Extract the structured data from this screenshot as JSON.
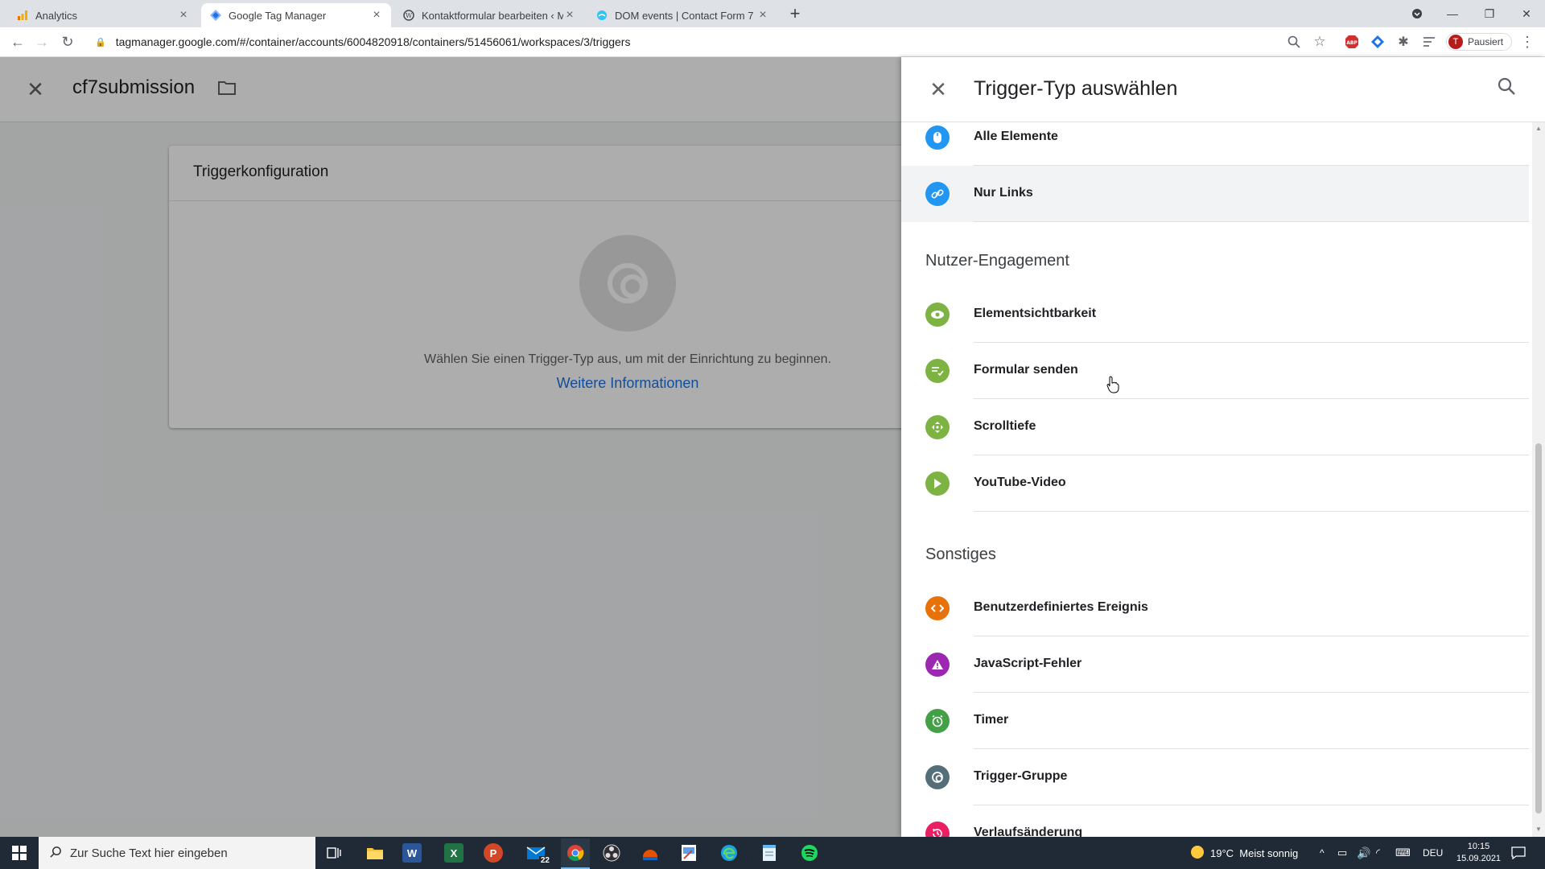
{
  "browser": {
    "tabs": [
      {
        "label": "Analytics",
        "icon": "analytics-icon",
        "active": false
      },
      {
        "label": "Google Tag Manager",
        "icon": "gtm-icon",
        "active": true
      },
      {
        "label": "Kontaktformular bearbeiten ‹ Me",
        "icon": "wordpress-icon",
        "active": false
      },
      {
        "label": "DOM events | Contact Form 7",
        "icon": "cf7-icon",
        "active": false
      }
    ],
    "url": "tagmanager.google.com/#/container/accounts/6004820918/containers/51456061/workspaces/3/triggers",
    "profile_initial": "T",
    "profile_label": "Pausiert"
  },
  "gtm": {
    "trigger_name": "cf7submission",
    "card_title": "Triggerkonfiguration",
    "card_hint": "Wählen Sie einen Trigger-Typ aus, um mit der Einrichtung zu beginnen.",
    "card_link": "Weitere Informationen"
  },
  "panel": {
    "title": "Trigger-Typ auswählen",
    "items_top": [
      {
        "label": "Alle Elemente",
        "icon": "mouse-icon",
        "color": "#2196f3"
      },
      {
        "label": "Nur Links",
        "icon": "link-icon",
        "color": "#2196f3"
      }
    ],
    "section_engagement": "Nutzer-Engagement",
    "items_engagement": [
      {
        "label": "Elementsichtbarkeit",
        "icon": "eye-icon",
        "color": "#7cb342"
      },
      {
        "label": "Formular senden",
        "icon": "form-icon",
        "color": "#7cb342"
      },
      {
        "label": "Scrolltiefe",
        "icon": "scroll-icon",
        "color": "#7cb342"
      },
      {
        "label": "YouTube-Video",
        "icon": "play-icon",
        "color": "#7cb342"
      }
    ],
    "section_other": "Sonstiges",
    "items_other": [
      {
        "label": "Benutzerdefiniertes Ereignis",
        "icon": "code-icon",
        "color": "#e8710a"
      },
      {
        "label": "JavaScript-Fehler",
        "icon": "warning-icon",
        "color": "#9c27b0"
      },
      {
        "label": "Timer",
        "icon": "timer-icon",
        "color": "#43a047"
      },
      {
        "label": "Trigger-Gruppe",
        "icon": "trigger-group-icon",
        "color": "#546e7a"
      },
      {
        "label": "Verlaufsänderung",
        "icon": "history-icon",
        "color": "#e91e63"
      }
    ]
  },
  "taskbar": {
    "search_placeholder": "Zur Suche Text hier eingeben",
    "mail_badge": "22",
    "weather": "19°C  Meist sonnig",
    "language": "DEU",
    "time": "10:15",
    "date": "15.09.2021"
  }
}
